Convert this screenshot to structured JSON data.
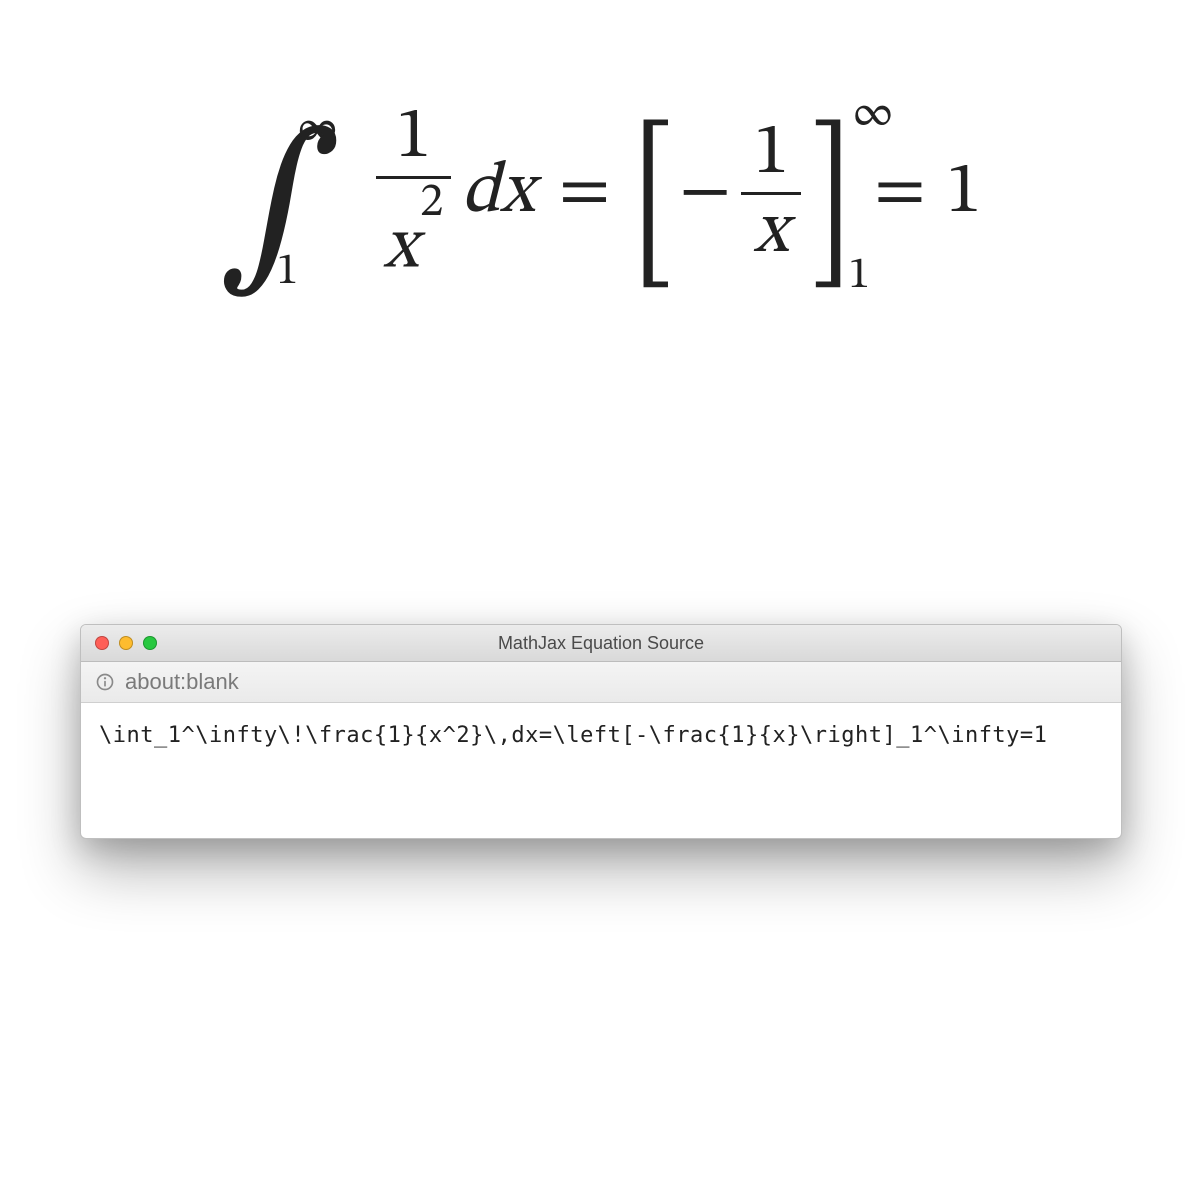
{
  "equation": {
    "int_lower": "1",
    "int_upper": "∞",
    "frac1_num": "1",
    "frac1_den_base": "x",
    "frac1_den_exp": "2",
    "dx": "dx",
    "eq1": "=",
    "lbracket": "[",
    "minus": "−",
    "frac2_num": "1",
    "frac2_den": "x",
    "rbracket": "]",
    "brk_lower": "1",
    "brk_upper": "∞",
    "eq2": "=",
    "result": "1"
  },
  "dialog": {
    "title": "MathJax Equation Source",
    "address": "about:blank",
    "source": "\\int_1^\\infty\\!\\frac{1}{x^2}\\,dx=\\left[-\\frac{1}{x}\\right]_1^\\infty=1"
  }
}
